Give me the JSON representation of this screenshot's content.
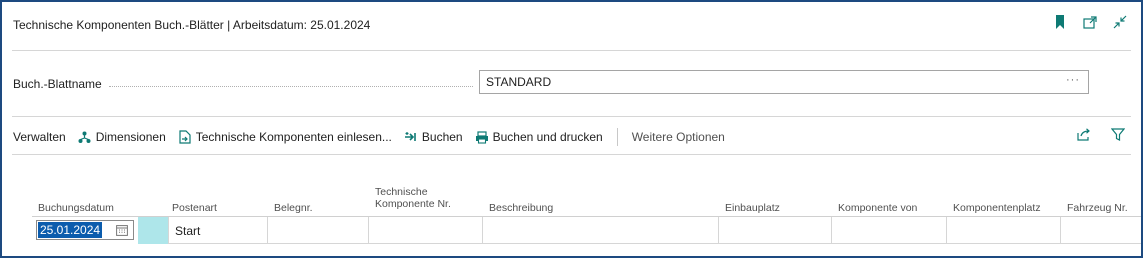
{
  "header": {
    "title": "Technische Komponenten Buch.-Blätter | Arbeitsdatum: 25.01.2024",
    "icons": [
      "bookmark-icon",
      "open-new-window-icon",
      "collapse-icon"
    ]
  },
  "field": {
    "label": "Buch.-Blattname",
    "value": "STANDARD",
    "more": "···"
  },
  "actions": {
    "manage": "Verwalten",
    "dimensions": "Dimensionen",
    "import": "Technische Komponenten einlesen...",
    "post": "Buchen",
    "post_print": "Buchen und drucken",
    "more_options": "Weitere Optionen"
  },
  "table": {
    "headers": {
      "posting_date": "Buchungsdatum",
      "entry_type": "Postenart",
      "doc_no": "Belegnr.",
      "tech_comp_1": "Technische",
      "tech_comp_2": "Komponente Nr.",
      "description": "Beschreibung",
      "install_pos": "Einbauplatz",
      "comp_from": "Komponente von",
      "comp_pos": "Komponentenplatz",
      "vehicle_no": "Fahrzeug Nr."
    },
    "rows": [
      {
        "posting_date": "25.01.2024",
        "entry_type": "Start"
      }
    ]
  },
  "colors": {
    "accent": "#0e7a74",
    "border": "#1d4a80",
    "selection": "#0b5cad",
    "row_highlight": "#aee6ea"
  }
}
